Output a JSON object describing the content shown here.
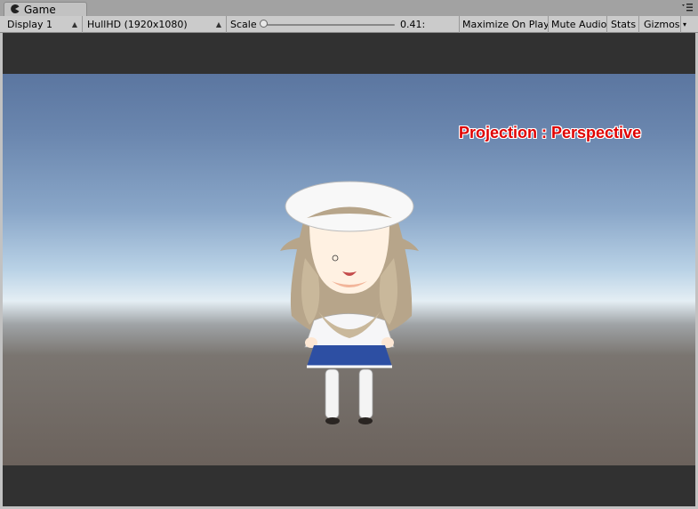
{
  "tab": {
    "title": "Game",
    "icon": "pacman-game-icon"
  },
  "toolbar": {
    "display": "Display 1",
    "resolution": "HullHD (1920x1080)",
    "scale_label": "Scale",
    "scale_value": "0.41:",
    "scale_fraction": 0.0,
    "maximize_on_play": "Maximize On Play",
    "mute_audio": "Mute Audio",
    "stats": "Stats",
    "gizmos": "Gizmos"
  },
  "viewport": {
    "overlay_text": "Projection : Perspective",
    "overlay_color": "#e00000"
  }
}
